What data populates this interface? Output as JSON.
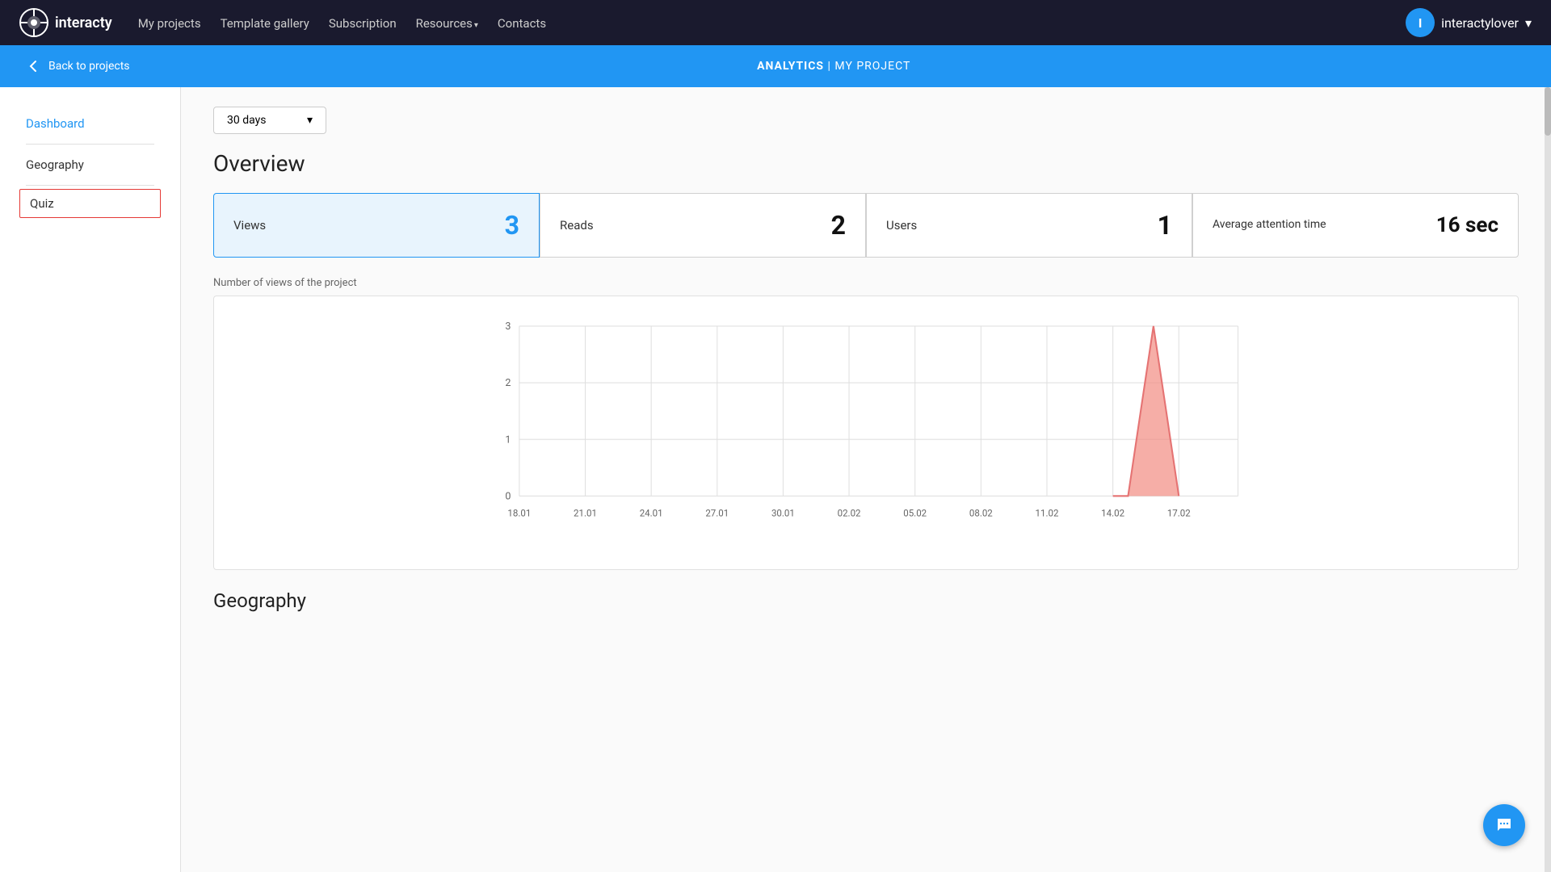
{
  "nav": {
    "logo_text": "interacty",
    "links": [
      {
        "label": "My projects",
        "id": "my-projects"
      },
      {
        "label": "Template gallery",
        "id": "template-gallery"
      },
      {
        "label": "Subscription",
        "id": "subscription"
      },
      {
        "label": "Resources",
        "id": "resources",
        "has_arrow": true
      },
      {
        "label": "Contacts",
        "id": "contacts"
      }
    ],
    "user": {
      "avatar_initial": "I",
      "username": "interactylover",
      "chevron": "▾"
    }
  },
  "blue_bar": {
    "back_label": "Back to projects",
    "analytics_label": "ANALYTICS",
    "separator": "|",
    "project_label": "MY PROJECT"
  },
  "sidebar": {
    "items": [
      {
        "label": "Dashboard",
        "active": true,
        "id": "dashboard"
      },
      {
        "label": "Geography",
        "active": false,
        "id": "geography"
      },
      {
        "label": "Quiz",
        "active": false,
        "id": "quiz",
        "outlined": true
      }
    ]
  },
  "date_filter": {
    "value": "30 days",
    "chevron": "▾"
  },
  "overview": {
    "title": "Overview",
    "stat_cards": [
      {
        "label": "Views",
        "value": "3",
        "highlight": true
      },
      {
        "label": "Reads",
        "value": "2",
        "highlight": false
      },
      {
        "label": "Users",
        "value": "1",
        "highlight": false
      },
      {
        "label": "Average attention time",
        "value": "16 sec",
        "highlight": false,
        "multiline": true
      }
    ]
  },
  "chart": {
    "label": "Number of views of the project",
    "y_labels": [
      "3",
      "2",
      "1",
      "0"
    ],
    "x_labels": [
      "18.01",
      "21.01",
      "24.01",
      "27.01",
      "30.01",
      "02.02",
      "05.02",
      "08.02",
      "11.02",
      "14.02",
      "17.02"
    ],
    "accent_color": "#f28b82",
    "peak_date": "16.02"
  },
  "geography_section": {
    "title": "Geography"
  },
  "chat_icon": "💬"
}
